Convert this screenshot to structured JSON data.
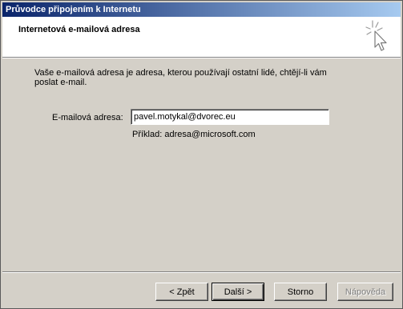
{
  "window": {
    "title": "Průvodce připojením k Internetu"
  },
  "header": {
    "title": "Internetová e-mailová adresa",
    "icon": "wizard-sparkle-cursor-icon"
  },
  "body": {
    "description": "Vaše e-mailová adresa je adresa, kterou používají ostatní lidé, chtějí-li vám poslat e-mail.",
    "email_label": "E-mailová adresa:",
    "email_value": "pavel.motykal@dvorec.eu",
    "example": "Příklad: adresa@microsoft.com"
  },
  "buttons": {
    "back": "< Zpět",
    "next": "Další >",
    "cancel": "Storno",
    "help": "Nápověda"
  },
  "colors": {
    "titlebar_start": "#0a246a",
    "titlebar_end": "#a6caf0",
    "dialog_bg": "#d4d0c8",
    "header_bg": "#ffffff",
    "disabled_text": "#808080"
  }
}
